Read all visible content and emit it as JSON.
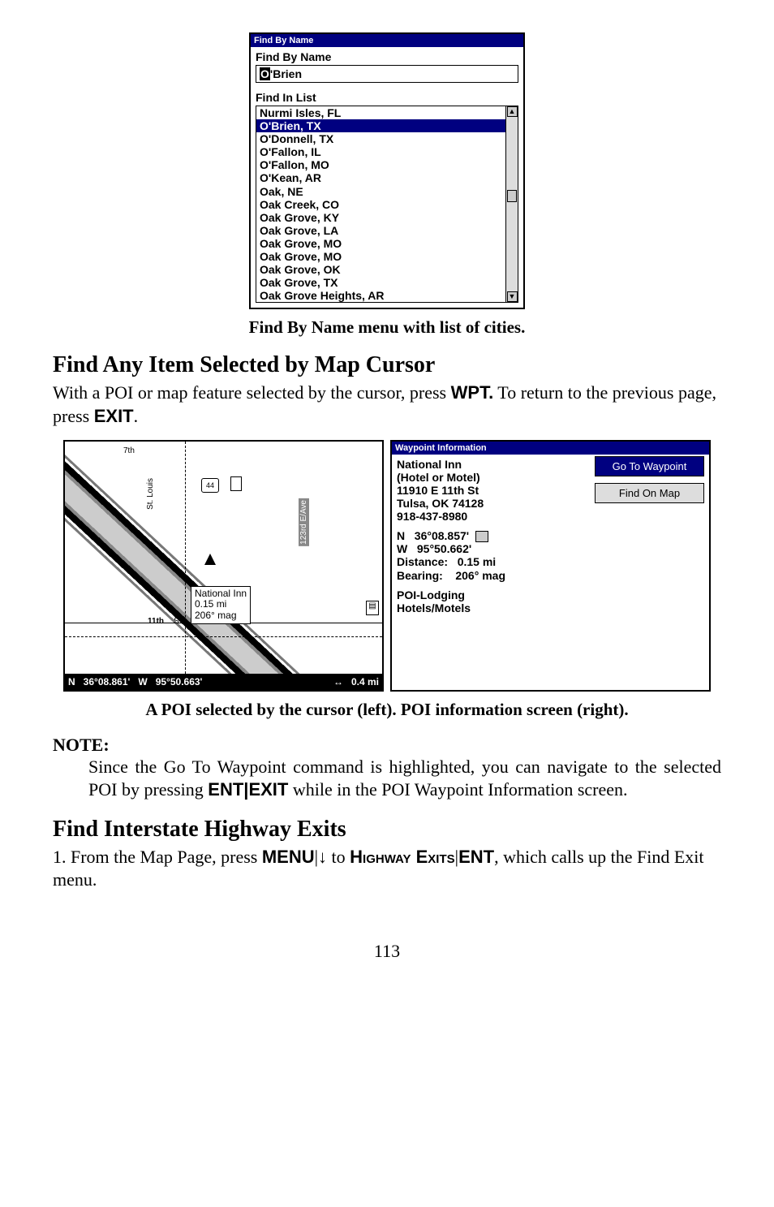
{
  "fbn": {
    "titlebar": "Find By Name",
    "label1": "Find By Name",
    "input_cursor": "O",
    "input_rest": "'Brien",
    "label2": "Find In List",
    "items": [
      "Nurmi Isles, FL",
      "O'Brien, TX",
      "O'Donnell, TX",
      "O'Fallon, IL",
      "O'Fallon, MO",
      "O'Kean, AR",
      "Oak, NE",
      "Oak Creek, CO",
      "Oak Grove, KY",
      "Oak Grove, LA",
      "Oak Grove, MO",
      "Oak Grove, MO",
      "Oak Grove, OK",
      "Oak Grove, TX",
      "Oak Grove Heights, AR"
    ],
    "selected_index": 1
  },
  "caption1": "Find By Name menu with list of cities.",
  "section1_title": "Find Any Item Selected by Map Cursor",
  "para1_a": "With a POI or map feature selected by the cursor, press ",
  "para1_key1": "WPT.",
  "para1_b": " To return to the previous page, press ",
  "para1_key2": "EXIT",
  "para1_c": ".",
  "map": {
    "shield1": "44",
    "label_name": "National Inn",
    "label_dist": "0.15 mi",
    "label_bearing": "206° mag",
    "street_11th_prefix": "11th",
    "street_11th_suffix": "S",
    "street_123rd": "123rd E/Ave",
    "street_7th": "7th",
    "street_stlouis": "St. Louis",
    "status_N": "N",
    "status_lat": "36°08.861'",
    "status_W": "W",
    "status_lon": "95°50.663'",
    "status_arrows": "↔",
    "status_scale": "0.4 mi"
  },
  "wp": {
    "titlebar": "Waypoint Information",
    "name": "National Inn",
    "type": "(Hotel or Motel)",
    "addr": "11910 E 11th St",
    "city": "Tulsa, OK 74128",
    "phone": "918-437-8980",
    "lat_dir": "N",
    "lat": "36°08.857'",
    "lon_dir": "W",
    "lon": "95°50.662'",
    "dist_lbl": "Distance:",
    "dist_val": "0.15 mi",
    "bear_lbl": "Bearing:",
    "bear_val": "206° mag",
    "cat1": "POI-Lodging",
    "cat2": "Hotels/Motels",
    "btn_go": "Go To Waypoint",
    "btn_find": "Find On Map"
  },
  "caption2": "A POI selected by the cursor (left). POI information screen (right).",
  "note_head": "NOTE:",
  "note_a": "Since the Go To Waypoint command is highlighted, you can navigate to the selected POI by pressing ",
  "note_key1": "ENT",
  "note_sep": "|",
  "note_key2": "EXIT",
  "note_b": " while in the POI Waypoint Information screen.",
  "section2_title": "Find Interstate Highway Exits",
  "para2_a": "1. From the Map Page, press ",
  "para2_key1": "MENU",
  "para2_sep1": "|",
  "para2_arrow": "↓",
  "para2_b": " to ",
  "para2_key2": "Highway Exits",
  "para2_sep2": "|",
  "para2_key3": "ENT",
  "para2_c": ", which calls up the Find Exit menu.",
  "page_num": "113"
}
